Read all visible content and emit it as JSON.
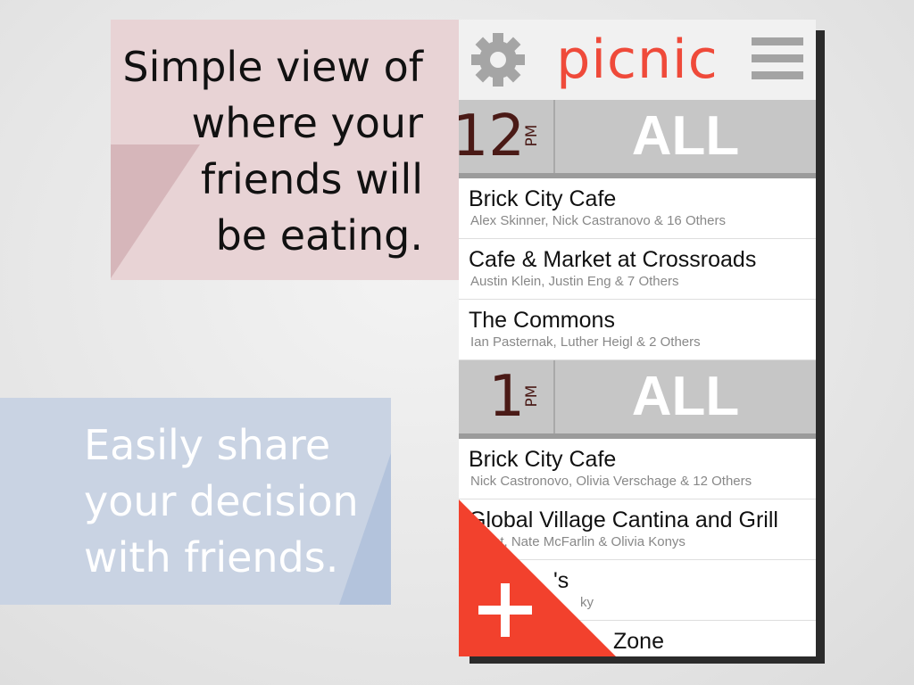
{
  "callouts": {
    "top": "Simple view of\nwhere your\nfriends will\nbe eating.",
    "bottom": "Easily share\nyour decision\nwith friends."
  },
  "app": {
    "title": "picnic",
    "settings_icon": "gear-icon",
    "menu_icon": "hamburger-menu-icon",
    "accent_color": "#ef4a3a"
  },
  "groups": [
    {
      "hour": "12",
      "ampm": "PM",
      "filter": "ALL",
      "places": [
        {
          "name": "Brick City Cafe",
          "friends": "Alex Skinner, Nick Castranovo & 16 Others"
        },
        {
          "name": "Cafe & Market at Crossroads",
          "friends": "Austin Klein, Justin Eng & 7 Others"
        },
        {
          "name": "The Commons",
          "friends": "Ian Pasternak, Luther Heigl & 2 Others"
        }
      ]
    },
    {
      "hour": "1",
      "ampm": "PM",
      "filter": "ALL",
      "places": [
        {
          "name": "Brick City Cafe",
          "friends": "Nick Castronovo, Olivia Verschage & 12 Others"
        },
        {
          "name": "Global Village Cantina and Grill",
          "friends": "Grant, Nate McFarlin & Olivia Konys"
        },
        {
          "name": "'s",
          "friends": "ky"
        },
        {
          "name": "Zone",
          "friends": ""
        }
      ]
    }
  ],
  "fab": {
    "icon": "plus-icon"
  }
}
